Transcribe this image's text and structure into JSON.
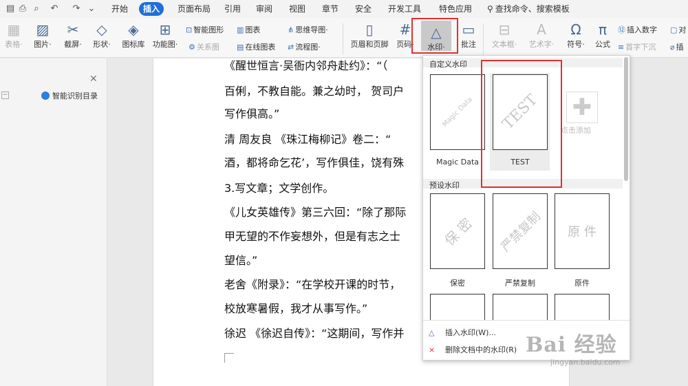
{
  "menubar": {
    "tabs": [
      "开始",
      "插入",
      "页面布局",
      "引用",
      "审阅",
      "视图",
      "章节",
      "安全",
      "开发工具",
      "特色应用"
    ],
    "active_tab": "插入",
    "search": "查找命令、搜索模板"
  },
  "ribbon": {
    "table": "表格·",
    "picture": "图片·",
    "screenshot": "截屏·",
    "shape": "形状·",
    "icon_lib": "图标库",
    "func_chart": "功能图·",
    "smart_art": "智能图形",
    "chart": "图表",
    "relation": "关系图",
    "online_chart": "在线图表",
    "mind_map": "思维导图·",
    "flow_chart": "流程图·",
    "header_footer": "页眉和页脚",
    "page_num": "页码·",
    "watermark": "水印·",
    "comment": "批注",
    "textbox": "文本框·",
    "word_art": "艺术字·",
    "symbol": "符号·",
    "formula": "公式",
    "insert_number": "插入数字",
    "drop_cap": "首字下沉",
    "pair": "对",
    "insert_trunc": "插"
  },
  "leftpane": {
    "smart_toc": "智能识别目录"
  },
  "document": {
    "lines": [
      "《醒世恒言·吴衙内邻舟赴约》：“（",
      "百俐，不教自能。兼之幼时， 贺司户",
      "写作俱高。”",
      "清  周友良  《珠江梅柳记》卷二：“",
      "酒，都将命乞花’，写作俱佳，饶有殊",
      "3.写文章；文学创作。",
      "《儿女英雄传》第三六回：“除了那际",
      "甲无望的不作妄想外，但是有志之士",
      "望信。”",
      "老舍《附录》：“在学校开课的时节，",
      "校放寒暑假，我才从事写作。”",
      "徐迟  《徐迟自传》：“这期间，写作并"
    ]
  },
  "watermark_panel": {
    "custom_title": "自定义水印",
    "custom": [
      {
        "label": "Magic Data",
        "mark": "Magic Data"
      },
      {
        "label": "TEST",
        "mark": "TEST"
      }
    ],
    "add_label": "点击添加",
    "preset_title": "预设水印",
    "preset": [
      {
        "label": "保密",
        "mark": "保 密"
      },
      {
        "label": "严禁复制",
        "mark": "严禁复制"
      },
      {
        "label": "原件",
        "mark": "原 件"
      }
    ],
    "insert_action": "插入水印(W)...",
    "delete_action": "删除文档中的水印(R)"
  },
  "site_watermark": {
    "brand": "Bai  经验",
    "url": "jingyan.baidu.com"
  },
  "colors": {
    "active_tab": "#1e6fd9",
    "highlight_box": "#e03030"
  }
}
